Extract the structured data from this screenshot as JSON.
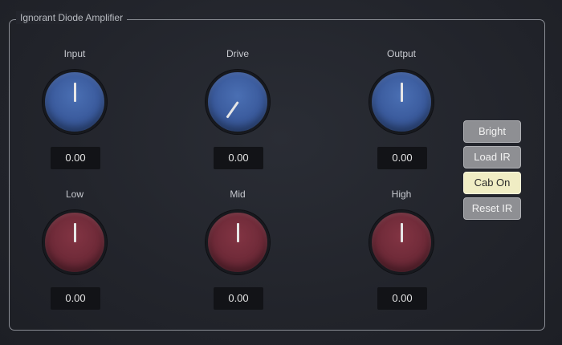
{
  "group": {
    "title": "Ignorant Diode Amplifier"
  },
  "knobs": [
    {
      "label": "Input",
      "value": "0.00",
      "color": "blue",
      "angle": 0
    },
    {
      "label": "Drive",
      "value": "0.00",
      "color": "blue",
      "angle": -145
    },
    {
      "label": "Output",
      "value": "0.00",
      "color": "blue",
      "angle": 0
    },
    {
      "label": "Low",
      "value": "0.00",
      "color": "red",
      "angle": 0
    },
    {
      "label": "Mid",
      "value": "0.00",
      "color": "red",
      "angle": 0
    },
    {
      "label": "High",
      "value": "0.00",
      "color": "red",
      "angle": 0
    }
  ],
  "buttons": [
    {
      "label": "Bright",
      "active": false
    },
    {
      "label": "Load IR",
      "active": false
    },
    {
      "label": "Cab On",
      "active": true
    },
    {
      "label": "Reset IR",
      "active": false
    }
  ],
  "colors": {
    "knob_blue": "#3a5a9c",
    "knob_red": "#6e2a38",
    "button_active": "#f0edc4",
    "button_inactive": "#8e8f93"
  }
}
